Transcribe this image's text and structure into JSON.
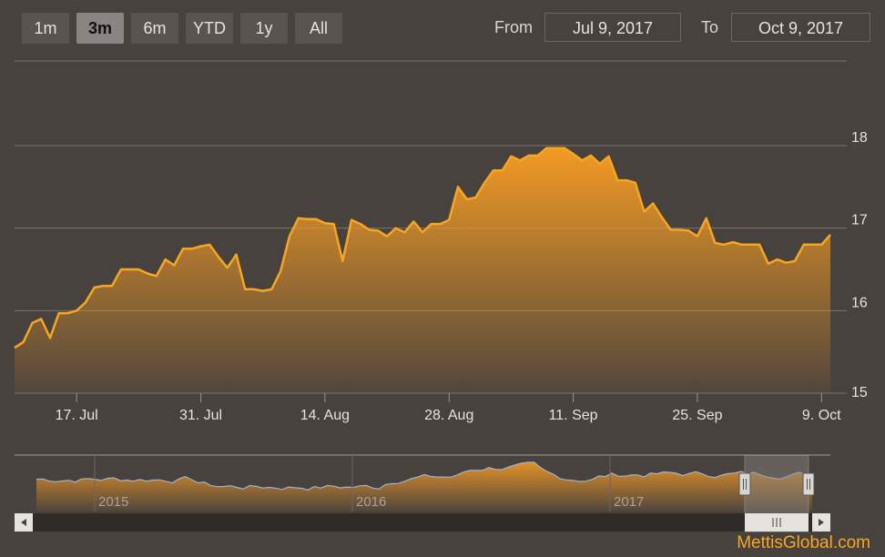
{
  "range_selector": {
    "buttons": [
      {
        "label": "1m",
        "active": false
      },
      {
        "label": "3m",
        "active": true
      },
      {
        "label": "6m",
        "active": false
      },
      {
        "label": "YTD",
        "active": false
      },
      {
        "label": "1y",
        "active": false
      },
      {
        "label": "All",
        "active": false
      }
    ],
    "from_label": "From",
    "from_value": "Jul 9, 2017",
    "to_label": "To",
    "to_value": "Oct 9, 2017"
  },
  "colors": {
    "line": "#f6a623",
    "fill_top": "#f39a24",
    "navigator_line": "#9fb3d0",
    "background": "#48423e"
  },
  "chart_data": {
    "type": "area",
    "title": "",
    "xlabel": "",
    "ylabel": "",
    "ylim": [
      15,
      18
    ],
    "yticks": [
      15,
      16,
      17,
      18
    ],
    "xlim": [
      "2017-07-10",
      "2017-10-10"
    ],
    "xtick_labels": [
      {
        "date": "2017-07-17",
        "label": "17. Jul"
      },
      {
        "date": "2017-07-31",
        "label": "31. Jul"
      },
      {
        "date": "2017-08-14",
        "label": "14. Aug"
      },
      {
        "date": "2017-08-28",
        "label": "28. Aug"
      },
      {
        "date": "2017-09-11",
        "label": "11. Sep"
      },
      {
        "date": "2017-09-25",
        "label": "25. Sep"
      },
      {
        "date": "2017-10-09",
        "label": "9. Oct"
      }
    ],
    "grid": true,
    "series": [
      {
        "name": "",
        "points": [
          [
            "2017-07-10",
            15.55
          ],
          [
            "2017-07-11",
            15.62
          ],
          [
            "2017-07-12",
            15.85
          ],
          [
            "2017-07-13",
            15.9
          ],
          [
            "2017-07-14",
            15.67
          ],
          [
            "2017-07-15",
            15.97
          ],
          [
            "2017-07-16",
            15.97
          ],
          [
            "2017-07-17",
            16.0
          ],
          [
            "2017-07-18",
            16.1
          ],
          [
            "2017-07-19",
            16.28
          ],
          [
            "2017-07-20",
            16.3
          ],
          [
            "2017-07-21",
            16.3
          ],
          [
            "2017-07-22",
            16.5
          ],
          [
            "2017-07-23",
            16.5
          ],
          [
            "2017-07-24",
            16.5
          ],
          [
            "2017-07-25",
            16.45
          ],
          [
            "2017-07-26",
            16.42
          ],
          [
            "2017-07-27",
            16.62
          ],
          [
            "2017-07-28",
            16.55
          ],
          [
            "2017-07-29",
            16.75
          ],
          [
            "2017-07-30",
            16.75
          ],
          [
            "2017-07-31",
            16.78
          ],
          [
            "2017-08-01",
            16.8
          ],
          [
            "2017-08-02",
            16.65
          ],
          [
            "2017-08-03",
            16.52
          ],
          [
            "2017-08-04",
            16.68
          ],
          [
            "2017-08-05",
            16.26
          ],
          [
            "2017-08-06",
            16.26
          ],
          [
            "2017-08-07",
            16.24
          ],
          [
            "2017-08-08",
            16.26
          ],
          [
            "2017-08-09",
            16.48
          ],
          [
            "2017-08-10",
            16.9
          ],
          [
            "2017-08-11",
            17.12
          ],
          [
            "2017-08-12",
            17.11
          ],
          [
            "2017-08-13",
            17.11
          ],
          [
            "2017-08-14",
            17.06
          ],
          [
            "2017-08-15",
            17.05
          ],
          [
            "2017-08-16",
            16.6
          ],
          [
            "2017-08-17",
            17.1
          ],
          [
            "2017-08-18",
            17.05
          ],
          [
            "2017-08-19",
            16.98
          ],
          [
            "2017-08-20",
            16.97
          ],
          [
            "2017-08-21",
            16.9
          ],
          [
            "2017-08-22",
            17.0
          ],
          [
            "2017-08-23",
            16.95
          ],
          [
            "2017-08-24",
            17.08
          ],
          [
            "2017-08-25",
            16.95
          ],
          [
            "2017-08-26",
            17.05
          ],
          [
            "2017-08-27",
            17.05
          ],
          [
            "2017-08-28",
            17.1
          ],
          [
            "2017-08-29",
            17.5
          ],
          [
            "2017-08-30",
            17.35
          ],
          [
            "2017-08-31",
            17.37
          ],
          [
            "2017-09-01",
            17.55
          ],
          [
            "2017-09-02",
            17.7
          ],
          [
            "2017-09-03",
            17.7
          ],
          [
            "2017-09-04",
            17.87
          ],
          [
            "2017-09-05",
            17.82
          ],
          [
            "2017-09-06",
            17.88
          ],
          [
            "2017-09-07",
            17.88
          ],
          [
            "2017-09-08",
            17.97
          ],
          [
            "2017-09-09",
            17.97
          ],
          [
            "2017-09-10",
            17.97
          ],
          [
            "2017-09-11",
            17.9
          ],
          [
            "2017-09-12",
            17.82
          ],
          [
            "2017-09-13",
            17.88
          ],
          [
            "2017-09-14",
            17.78
          ],
          [
            "2017-09-15",
            17.87
          ],
          [
            "2017-09-16",
            17.58
          ],
          [
            "2017-09-17",
            17.58
          ],
          [
            "2017-09-18",
            17.55
          ],
          [
            "2017-09-19",
            17.2
          ],
          [
            "2017-09-20",
            17.3
          ],
          [
            "2017-09-21",
            17.13
          ],
          [
            "2017-09-22",
            16.98
          ],
          [
            "2017-09-23",
            16.98
          ],
          [
            "2017-09-24",
            16.97
          ],
          [
            "2017-09-25",
            16.9
          ],
          [
            "2017-09-26",
            17.12
          ],
          [
            "2017-09-27",
            16.82
          ],
          [
            "2017-09-28",
            16.8
          ],
          [
            "2017-09-29",
            16.83
          ],
          [
            "2017-09-30",
            16.8
          ],
          [
            "2017-10-01",
            16.8
          ],
          [
            "2017-10-02",
            16.8
          ],
          [
            "2017-10-03",
            16.57
          ],
          [
            "2017-10-04",
            16.62
          ],
          [
            "2017-10-05",
            16.58
          ],
          [
            "2017-10-06",
            16.6
          ],
          [
            "2017-10-07",
            16.8
          ],
          [
            "2017-10-08",
            16.8
          ],
          [
            "2017-10-09",
            16.8
          ],
          [
            "2017-10-10",
            16.92
          ]
        ]
      }
    ]
  },
  "navigator": {
    "year_labels": [
      "2015",
      "2016",
      "2017"
    ],
    "selection": {
      "from": "Jul 9, 2017",
      "to": "Oct 9, 2017"
    }
  },
  "watermark": "MettisGlobal.com"
}
